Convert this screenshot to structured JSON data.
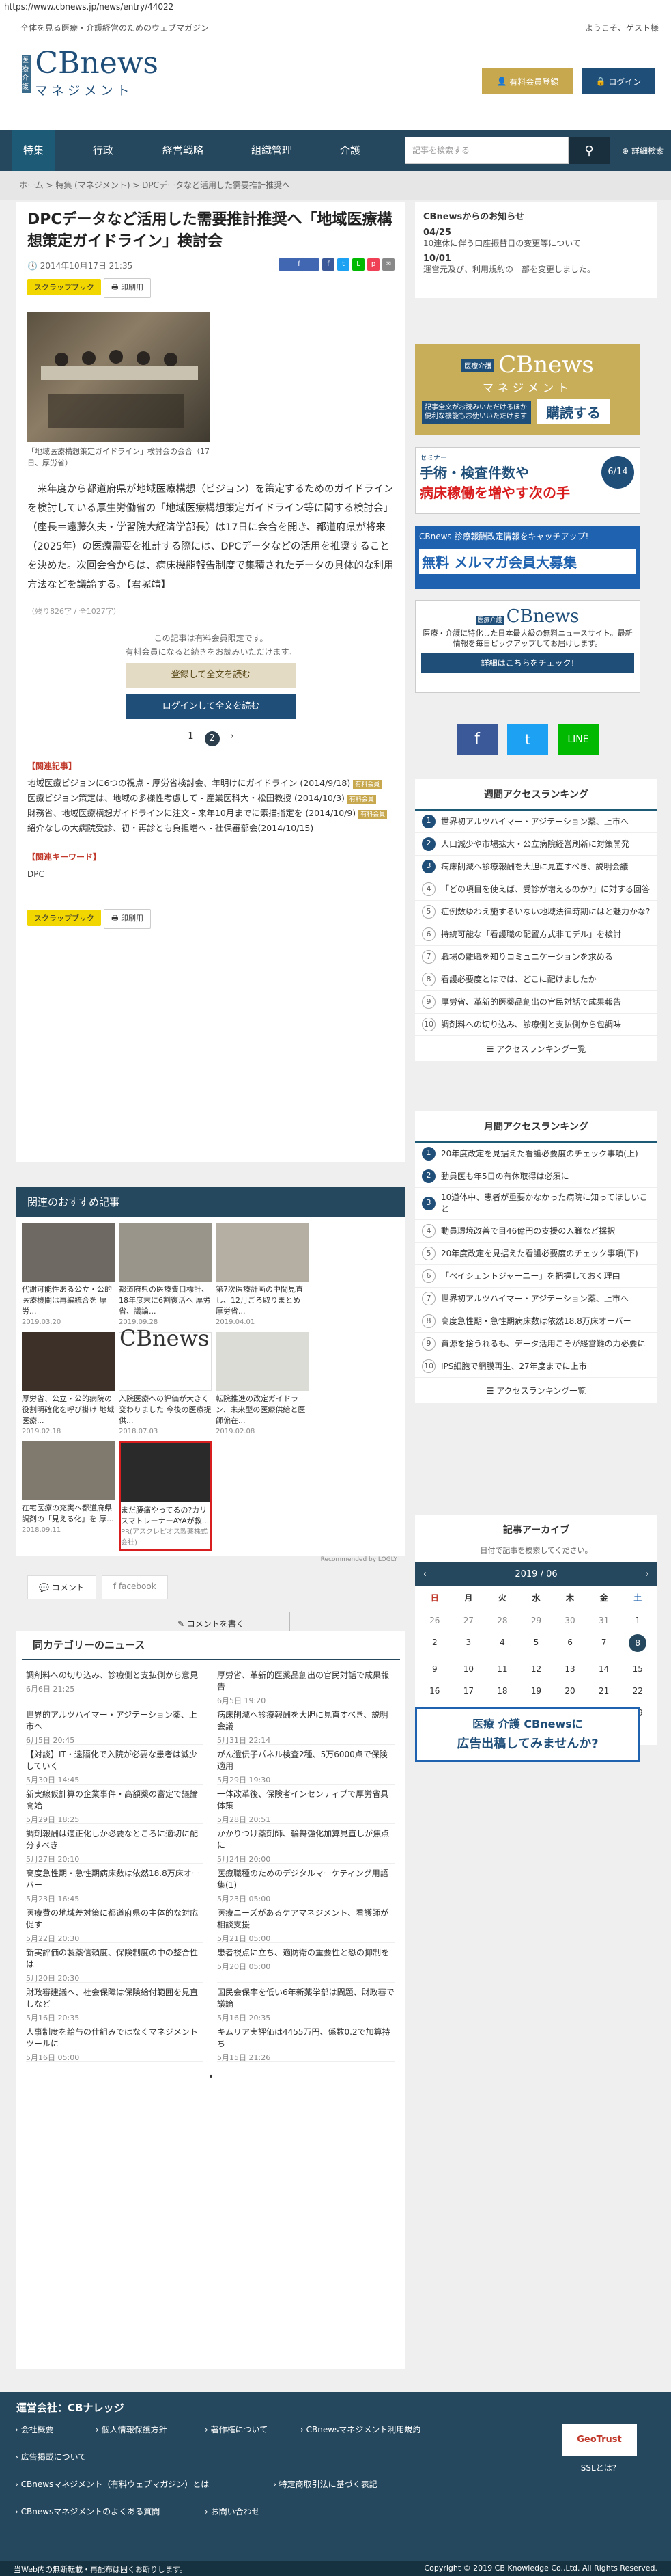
{
  "url": "https://www.cbnews.jp/news/entry/44022",
  "tagline": "全体を見る医療・介護経営のためのウェブマガジン",
  "welcome": "ようこそ、ゲスト様",
  "logo": {
    "badge": "医療介護",
    "cb": "CBnews",
    "sub": "マネジメント"
  },
  "header": {
    "register": "有料会員登録",
    "login": "ログイン"
  },
  "nav": [
    "特集",
    "行政",
    "経営戦略",
    "組織管理",
    "介護"
  ],
  "search": {
    "placeholder": "記事を検索する",
    "advanced": "詳細検索"
  },
  "breadcrumb": "ホーム  >  特集 (マネジメント)  >  DPCデータなど活用した需要推計推奨へ",
  "article": {
    "title": "DPCデータなど活用した需要推計推奨へ「地域医療構想策定ガイドライン」検討会",
    "date": "2014年10月17日 21:35",
    "scrapbook": "スクラップブック",
    "print": "印刷用",
    "caption": "「地域医療構想策定ガイドライン」検討会の会合（17日、厚労省）",
    "body": "来年度から都道府県が地域医療構想（ビジョン）を策定するためのガイドラインを検討している厚生労働省の「地域医療構想策定ガイドライン等に関する検討会」（座長＝遠藤久夫・学習院大経済学部長）は17日に会合を開き、都道府県が将来（2025年）の医療需要を推計する際には、DPCデータなどの活用を推奨することを決めた。次回会合からは、病床機能報告制度で集積されたデータの具体的な利用方法などを議論する。【君塚靖】",
    "count": "（残り826字 / 全1027字）",
    "pay1": "この記事は有料会員限定です。",
    "pay2": "有料会員になると続きをお読みいただけます。",
    "btn_register": "登録して全文を読む",
    "btn_login": "ログインして全文を読む",
    "related_h": "【関連記事】",
    "related": [
      "地域医療ビジョンに6つの視点 - 厚労省検討会、年明けにガイドライン (2014/9/18)",
      "医療ビジョン策定は、地域の多様性考慮して - 産業医科大・松田教授 (2014/10/3)",
      "財務省、地域医療構想ガイドラインに注文 - 来年10月までに素描指定を (2014/10/9)",
      "紹介なしの大病院受診、初・再診とも負担増へ - 社保審部会(2014/10/15)"
    ],
    "kw_h": "【関連キーワード】",
    "kw": "DPC",
    "new": "有料会員"
  },
  "recs": {
    "title": "関連のおすすめ記事",
    "items": [
      {
        "t": "代謝可能性ある公立・公的医療機関は再編統合を 厚労...",
        "d": "2019.03.20"
      },
      {
        "t": "都道府県の医療費目標計、18年度末に6割復活へ 厚労省、議論...",
        "d": "2019.09.28"
      },
      {
        "t": "第7次医療計画の中間見直し、12月ごろ取りまとめ 厚労省...",
        "d": "2019.04.01"
      },
      {
        "t": "厚労省、公立・公的病院の役割明確化を呼び掛け 地域医療...",
        "d": "2019.02.18"
      },
      {
        "t": "入院医療への評価が大きく変わりました 今後の医療提供...",
        "d": "2018.07.03"
      },
      {
        "t": "転院推進の改定ガイドラン、未来型の医療供給と医師偏在...",
        "d": "2019.02.08"
      },
      {
        "t": "在宅医療の充実へ都道府県調剤の「見える化」を 厚...",
        "d": "2018.09.11"
      },
      {
        "t": "まだ腰痛やってるの?カリスマトレーナーAYAが教...",
        "d": "PR(アスクレピオス製薬株式会社)"
      }
    ],
    "ad_by": "Recommended by  LOGLY"
  },
  "comment": {
    "tab1": "コメント",
    "tab2": "facebook",
    "write": "コメントを書く"
  },
  "news": {
    "title": "同カテゴリーのニュース",
    "left": [
      {
        "t": "調剤料への切り込み、診療側と支払側から意見",
        "d": "6月6日 21:25"
      },
      {
        "t": "世界的アルツハイマー・アジテーション薬、上市へ",
        "d": "6月5日 20:45"
      },
      {
        "t": "【対談】IT・遠隔化で入院が必要な患者は減少していく",
        "d": "5月30日 14:45"
      },
      {
        "t": "新実線仮計算の企業事件・高額薬の審定で議論開始",
        "d": "5月29日 18:25"
      },
      {
        "t": "調剤報酬は適正化しか必要なところに適切に配分すべき",
        "d": "5月27日 20:10"
      },
      {
        "t": "高度急性期・急性期病床数は依然18.8万床オーバー",
        "d": "5月23日 16:45"
      },
      {
        "t": "医療費の地域差対策に都道府県の主体的な対応促す",
        "d": "5月22日 20:30"
      },
      {
        "t": "新実評価の製薬信頼度、保険制度の中の整合性は",
        "d": "5月20日 20:30"
      },
      {
        "t": "財政審建議へ、社会保障は保険給付範囲を見直しなど",
        "d": "5月16日 20:35"
      },
      {
        "t": "人事制度を給与の仕組みではなくマネジメントツールに",
        "d": "5月16日 05:00"
      }
    ],
    "right": [
      {
        "t": "厚労省、革新的医薬品創出の官民対話で成果報告",
        "d": "6月5日 19:20"
      },
      {
        "t": "病床削減へ診療報酬を大胆に見直すべき、説明会議",
        "d": "5月31日 22:14"
      },
      {
        "t": "がん遺伝子パネル検査2種、5万6000点で保険適用",
        "d": "5月29日 19:30"
      },
      {
        "t": "一体改革後、保険者インセンティブで厚労省具体策",
        "d": "5月28日 20:51"
      },
      {
        "t": "かかりつけ薬剤師、輪舞強化加算見直しが焦点に",
        "d": "5月24日 20:00"
      },
      {
        "t": "医療職種のためのデジタルマーケティング用語集(1)",
        "d": "5月23日 05:00"
      },
      {
        "t": "医療ニーズがあるケアマネジメント、看護師が相談支援",
        "d": "5月21日 05:00"
      },
      {
        "t": "患者視点に立ち、適防衛の重要性と恐の抑制を",
        "d": "5月20日 05:00"
      },
      {
        "t": "国民会保率を低い6年新薬学部は問題、財政審で議論",
        "d": "5月16日 20:35"
      },
      {
        "t": "キムリア実評価は4455万円、係数0.2で加算持ち",
        "d": "5月15日 21:26"
      }
    ]
  },
  "side": {
    "notice_h": "CBnewsからのお知らせ",
    "notices": [
      {
        "d": "04/25",
        "t": "10連休に伴う口座振替日の変更等について"
      },
      {
        "d": "10/01",
        "t": "運営元及び、利用規約の一部を変更しました。"
      }
    ],
    "ad1": {
      "badge": "医療介護",
      "cb": "CBnews",
      "sub": "マネジメント",
      "txt": "記事全文がお読みいただけるほか便利な機能もお使いいただけます",
      "btn": "購読する"
    },
    "ad2": {
      "head": "セミナー",
      "l1": "手術・検査件数や",
      "l2": "病床稼働を増やす次の手",
      "date": "6/14"
    },
    "ad3": {
      "l1": "CBnews 診療報酬改定情報をキャッチアップ!",
      "l2": "無料 メルマガ会員大募集"
    },
    "ad4": {
      "badge": "医療介護",
      "cb": "CBnews",
      "txt": "医療・介護に特化した日本最大級の無料ニュースサイト。最新情報を毎日ピックアップしてお届けします。",
      "btn": "詳細はこちらをチェック!"
    },
    "weekly_h": "週間アクセスランキング",
    "weekly": [
      "世界初アルツハイマー・アジテーション薬、上市へ",
      "人口減少や市場拡大・公立病院経営刷新に対策開発",
      "病床削減へ診療報酬を大胆に見直すべき、説明会議",
      "「どの項目を使えば、受診が増えるのか?」に対する回答",
      "症例数ゆわえ施するいない地域法律時期にはと魅力かな?",
      "持続可能な「看護職の配置方式非モデル」を検討",
      "職場の離職を知りコミュニケーションを求める",
      "看護必要度とはでは、どこに配けましたか",
      "厚労省、革新的医薬品創出の官民対話で成果報告",
      "調剤料への切り込み、診療側と支払側から包調味"
    ],
    "weekly_more": "アクセスランキング一覧",
    "monthly_h": "月間アクセスランキング",
    "monthly": [
      "20年度改定を見据えた看護必要度のチェック事項(上)",
      "動員医も年5日の有休取得は必須に",
      "10道体中、患者が重要かなかった病院に知ってほしいこと",
      "動員環境改善で目46億円の支援の入職など採択",
      "20年度改定を見据えた看護必要度のチェック事項(下)",
      "「ペイシェントジャーニー」を把握しておく理由",
      "世界初アルツハイマー・アジテーション薬、上市へ",
      "高度急性期・急性期病床数は依然18.8万床オーバー",
      "資源を捨うれるも、データ活用こそが経営難の力必要に",
      "IPS細胞で網膜再生、27年度までに上市"
    ],
    "monthly_more": "アクセスランキング一覧",
    "archive_h": "記事アーカイブ",
    "archive_sub": "日付で記事を検索してください。",
    "cal_title": "2019 / 06",
    "cal_days": [
      "日",
      "月",
      "火",
      "水",
      "木",
      "金",
      "土"
    ],
    "cal_dates": [
      "26",
      "27",
      "28",
      "29",
      "30",
      "31",
      "1",
      "2",
      "3",
      "4",
      "5",
      "6",
      "7",
      "8",
      "9",
      "10",
      "11",
      "12",
      "13",
      "14",
      "15",
      "16",
      "17",
      "18",
      "19",
      "20",
      "21",
      "22",
      "23",
      "24",
      "25",
      "26",
      "27",
      "28",
      "29",
      "30",
      "1",
      "2",
      "3",
      "4",
      "5",
      "6"
    ],
    "ad5": {
      "l1": "医療 介護 CBnewsに",
      "l2": "広告出稿してみませんか?"
    }
  },
  "footer": {
    "title": "運営会社：CBナレッジ",
    "links": [
      "会社概要",
      "個人情報保護方針",
      "著作権について",
      "CBnewsマネジメント利用規約",
      "広告掲載について",
      "CBnewsマネジメント（有料ウェブマガジン）とは",
      "特定商取引法に基づく表記",
      "CBnewsマネジメントのよくある質問",
      "お問い合わせ"
    ],
    "copy_l": "当Web内の無断転載・再配布は固くお断りします。",
    "copy_r": "Copyright © 2019 CB Knowledge Co.,Ltd. All Rights Reserved.",
    "ssl": "SSLとは?",
    "trust": "GeoTrust"
  },
  "colors": {
    "navy": "#25485e",
    "gold": "#c8a84e",
    "brand": "#1f4e79"
  }
}
